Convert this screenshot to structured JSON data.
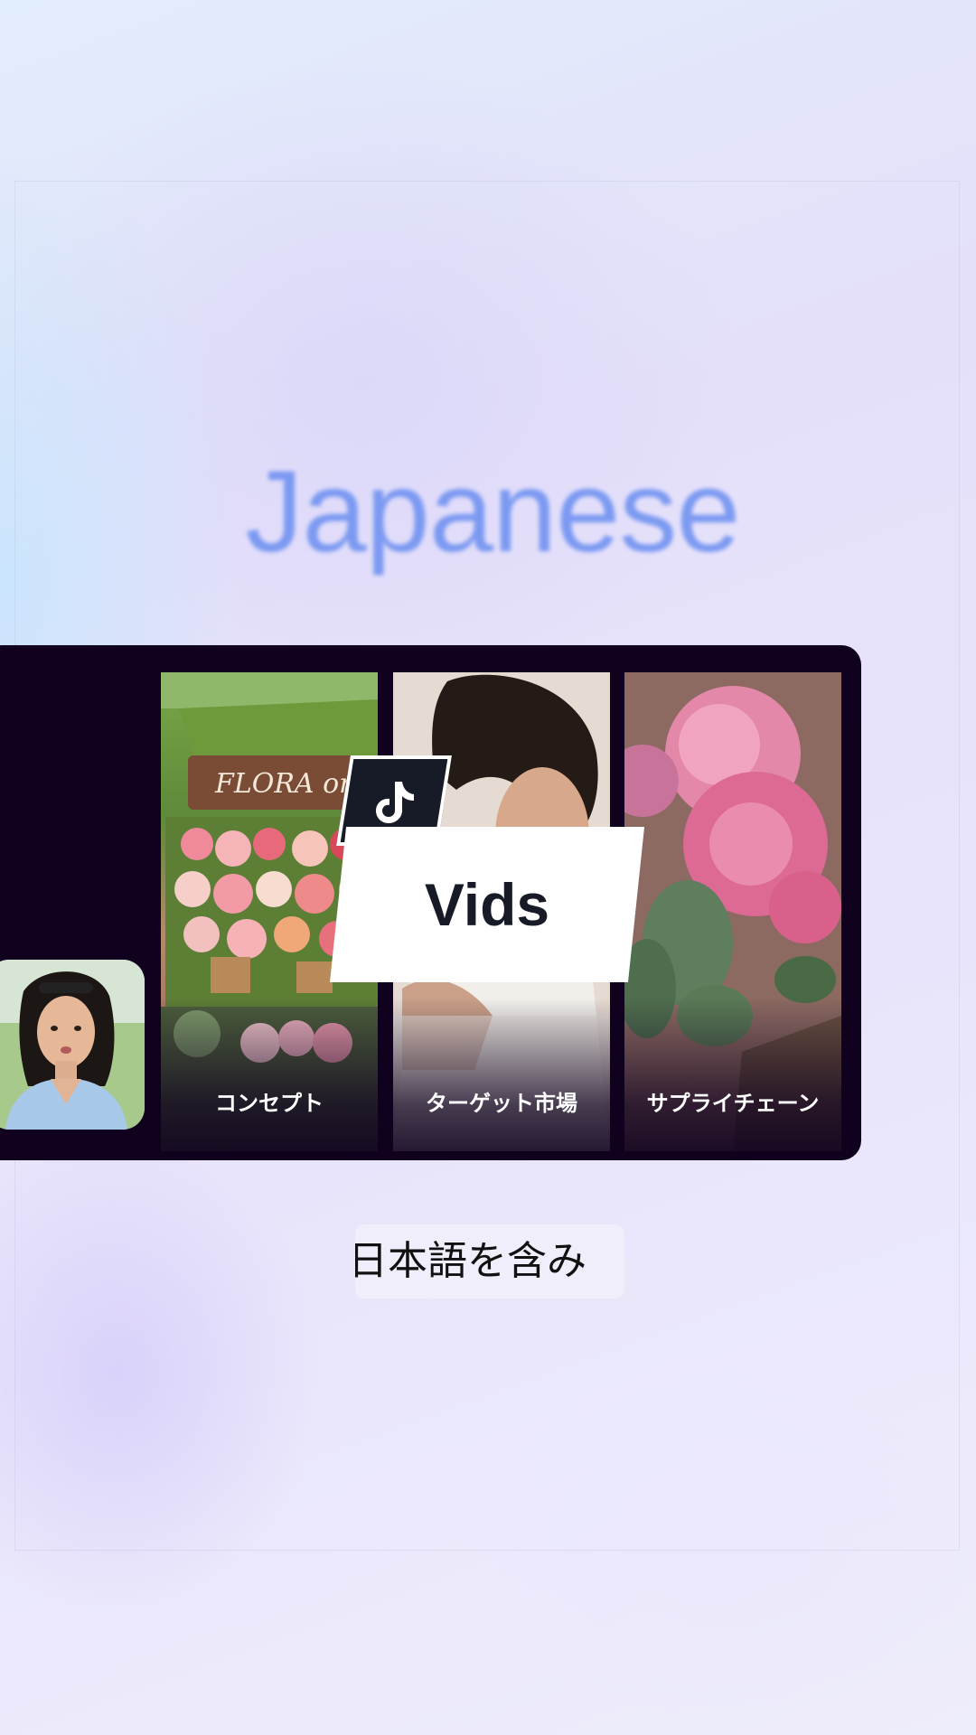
{
  "headline": "Japanese",
  "brand": {
    "logo_icon": "tiktok-note-icon",
    "name": "Vids"
  },
  "cards": [
    {
      "label": "コンセプト",
      "image": "flower-cart-photo"
    },
    {
      "label": "ターゲット市場",
      "image": "woman-with-flowers-photo"
    },
    {
      "label": "サプライチェーン",
      "image": "pink-roses-photo"
    }
  ],
  "avatar": {
    "image": "presenter-woman-photo"
  },
  "caption": "日本語を含み",
  "colors": {
    "headline": "#6a8ef0",
    "panel": "#10021f",
    "tile_dark": "#171b27",
    "tile_light": "#ffffff"
  }
}
